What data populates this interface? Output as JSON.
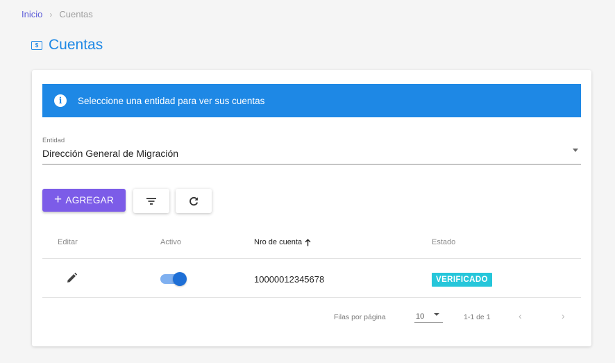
{
  "breadcrumb": {
    "home": "Inicio",
    "separator": "›",
    "current": "Cuentas"
  },
  "header": {
    "icon": "money-icon",
    "icon_glyph": "$",
    "title": "Cuentas"
  },
  "alert": {
    "icon": "info-icon",
    "icon_glyph": "i",
    "message": "Seleccione una entidad para ver sus cuentas",
    "color": "#1e88e5"
  },
  "entity_select": {
    "label": "Entidad",
    "value": "Dirección General de Migración"
  },
  "toolbar": {
    "add_plus": "+",
    "add_label": "AGREGAR",
    "add_color": "#7c5ce8",
    "filter_icon": "filter-icon",
    "refresh_icon": "refresh-icon"
  },
  "table": {
    "columns": {
      "edit": "Editar",
      "active": "Activo",
      "number": "Nro de cuenta",
      "status": "Estado"
    },
    "sort_icon": "arrow-up-icon",
    "rows": [
      {
        "active": true,
        "number": "10000012345678",
        "status": "VERIFICADO",
        "status_color": "#26c6da"
      }
    ]
  },
  "pagination": {
    "rows_per_page_label": "Filas por página",
    "rows_per_page": "10",
    "range": "1-1 de 1",
    "prev": "‹",
    "next": "›"
  }
}
